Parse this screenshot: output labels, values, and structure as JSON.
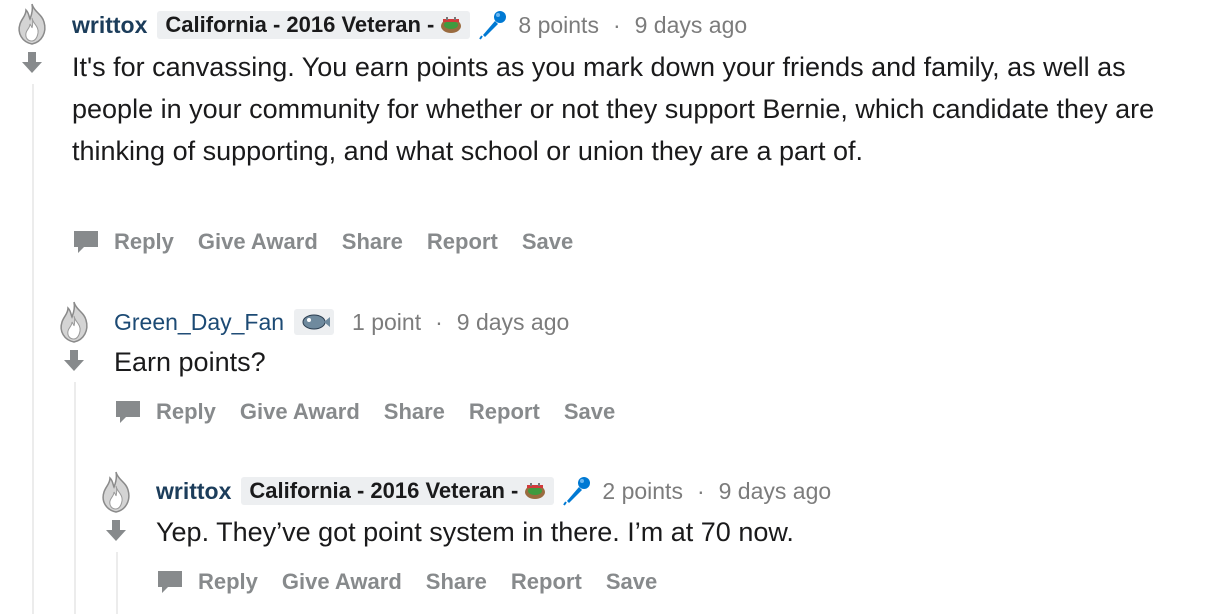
{
  "comments": [
    {
      "author": "writtox",
      "flair": "California - 2016 Veteran -",
      "points": "8 points",
      "time": "9 days ago",
      "body": "It's for canvassing. You earn points as you mark down your friends and family, as well as people in your community for whether or not they support Bernie, which candidate they are thinking of supporting, and what school or union they are a part of.",
      "actions": [
        "Reply",
        "Give Award",
        "Share",
        "Report",
        "Save"
      ]
    },
    {
      "author": "Green_Day_Fan",
      "points": "1 point",
      "time": "9 days ago",
      "body": "Earn points?",
      "actions": [
        "Reply",
        "Give Award",
        "Share",
        "Report",
        "Save"
      ]
    },
    {
      "author": "writtox",
      "flair": "California - 2016 Veteran -",
      "points": "2 points",
      "time": "9 days ago",
      "body": "Yep. They’ve got point system in there. I’m at 70 now.",
      "actions": [
        "Reply",
        "Give Award",
        "Share",
        "Report",
        "Save"
      ]
    }
  ],
  "colors": {
    "author": "#1c3d5b",
    "meta": "#7c7c7c",
    "action": "#878a8c",
    "flair_bg": "#edeff1",
    "mic": "#0079d3",
    "thread_line": "#ececec"
  },
  "icons": {
    "upvote": "flame-upvote-icon",
    "downvote": "arrow-down-icon",
    "flair": "stadium-icon",
    "mic": "microphone-icon",
    "chat": "chat-bubble-icon"
  }
}
